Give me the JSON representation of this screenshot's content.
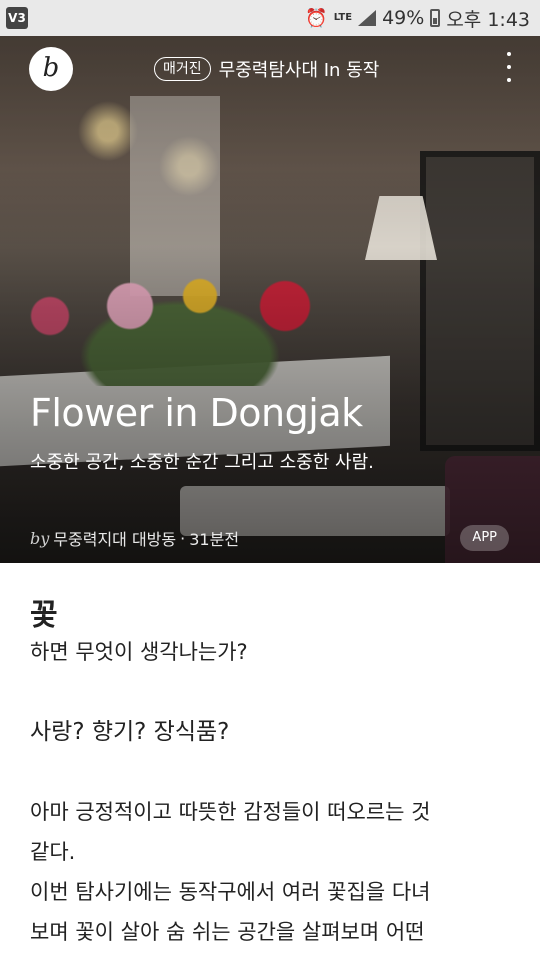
{
  "status_bar": {
    "app_icon_label": "V3",
    "network": "LTE",
    "battery": "49%",
    "time": "오후 1:43"
  },
  "topbar": {
    "logo_letter": "b",
    "magazine_badge": "매거진",
    "series_title": "무중력탐사대 In 동작"
  },
  "hero": {
    "title": "Flower in Dongjak",
    "subtitle": "소중한 공간, 소중한 순간 그리고 소중한 사람.",
    "byline_prefix": "by",
    "author": "무중력지대 대방동",
    "separator": "·",
    "time_ago": "31분전",
    "app_badge": "APP"
  },
  "article": {
    "heading": "꽃",
    "lines": [
      "하면 무엇이 생각나는가?",
      "사랑? 향기? 장식품?",
      "아마 긍정적이고 따뜻한 감정들이 떠오르는 것",
      "같다.",
      "이번 탐사기에는 동작구에서 여러 꽃집을 다녀",
      "보며 꽃이 살아 숨 쉬는 공간을 살펴보며 어떤"
    ]
  }
}
